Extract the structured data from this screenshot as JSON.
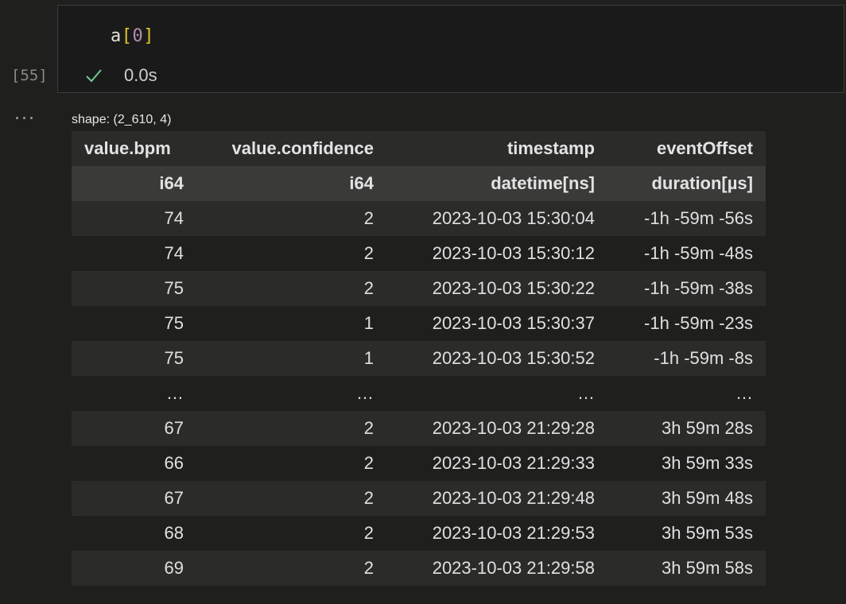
{
  "cell": {
    "code": {
      "var": "a",
      "open": "[",
      "index": "0",
      "close": "]"
    },
    "execution_count": "[55]",
    "status_duration": "0.0s",
    "status_icon": "check-icon"
  },
  "output": {
    "menu_icon": "ellipsis-icon",
    "shape_text": "shape: (2_610, 4)",
    "columns": [
      "value.bpm",
      "value.confidence",
      "timestamp",
      "eventOffset"
    ],
    "dtypes": [
      "i64",
      "i64",
      "datetime[ns]",
      "duration[µs]"
    ],
    "rows": [
      [
        "74",
        "2",
        "2023-10-03 15:30:04",
        "-1h -59m -56s"
      ],
      [
        "74",
        "2",
        "2023-10-03 15:30:12",
        "-1h -59m -48s"
      ],
      [
        "75",
        "2",
        "2023-10-03 15:30:22",
        "-1h -59m -38s"
      ],
      [
        "75",
        "1",
        "2023-10-03 15:30:37",
        "-1h -59m -23s"
      ],
      [
        "75",
        "1",
        "2023-10-03 15:30:52",
        "-1h -59m -8s"
      ],
      [
        "…",
        "…",
        "…",
        "…"
      ],
      [
        "67",
        "2",
        "2023-10-03 21:29:28",
        "3h 59m 28s"
      ],
      [
        "66",
        "2",
        "2023-10-03 21:29:33",
        "3h 59m 33s"
      ],
      [
        "67",
        "2",
        "2023-10-03 21:29:48",
        "3h 59m 48s"
      ],
      [
        "68",
        "2",
        "2023-10-03 21:29:53",
        "3h 59m 53s"
      ],
      [
        "69",
        "2",
        "2023-10-03 21:29:58",
        "3h 59m 58s"
      ]
    ]
  },
  "colors": {
    "background": "#1f1f1e",
    "success": "#73c991",
    "bracket": "#e2c32a",
    "number": "#b48ead"
  }
}
